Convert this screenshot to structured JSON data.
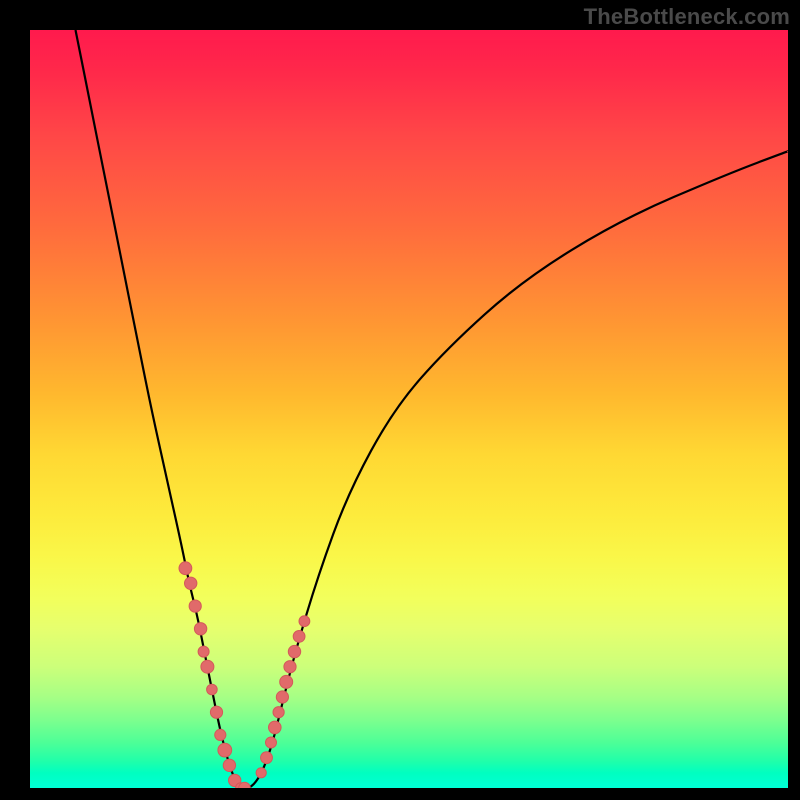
{
  "watermark": "TheBottleneck.com",
  "chart_data": {
    "type": "line",
    "title": "",
    "xlabel": "",
    "ylabel": "",
    "xlim": [
      0,
      100
    ],
    "ylim": [
      0,
      100
    ],
    "series": [
      {
        "name": "bottleneck-curve",
        "x": [
          6,
          8,
          10,
          12,
          14,
          16,
          18,
          20,
          21,
          22,
          23,
          24,
          25,
          26,
          27,
          28,
          29,
          30,
          31,
          32,
          33,
          35,
          38,
          42,
          48,
          55,
          65,
          78,
          92,
          100
        ],
        "y": [
          100,
          90,
          80,
          70,
          60,
          50,
          41,
          32,
          27,
          23,
          18,
          13,
          8,
          4,
          1,
          0,
          0,
          1,
          3,
          6,
          10,
          18,
          28,
          39,
          50,
          58,
          67,
          75,
          81,
          84
        ]
      }
    ],
    "markers": {
      "name": "data-points",
      "x": [
        20.5,
        21.2,
        21.8,
        22.5,
        22.9,
        23.4,
        24.0,
        24.6,
        25.1,
        25.7,
        26.3,
        27.0,
        27.8,
        28.3,
        30.5,
        31.2,
        31.8,
        32.3,
        32.8,
        33.3,
        33.8,
        34.3,
        34.9,
        35.5,
        36.2
      ],
      "y": [
        29,
        27,
        24,
        21,
        18,
        16,
        13,
        10,
        7,
        5,
        3,
        1,
        0,
        0,
        2,
        4,
        6,
        8,
        10,
        12,
        14,
        16,
        18,
        20,
        22
      ]
    },
    "colors": {
      "curve": "#000000",
      "marker_fill": "#e16a6a",
      "gradient_top": "#ff1a4d",
      "gradient_bottom": "#00ffd6"
    }
  }
}
